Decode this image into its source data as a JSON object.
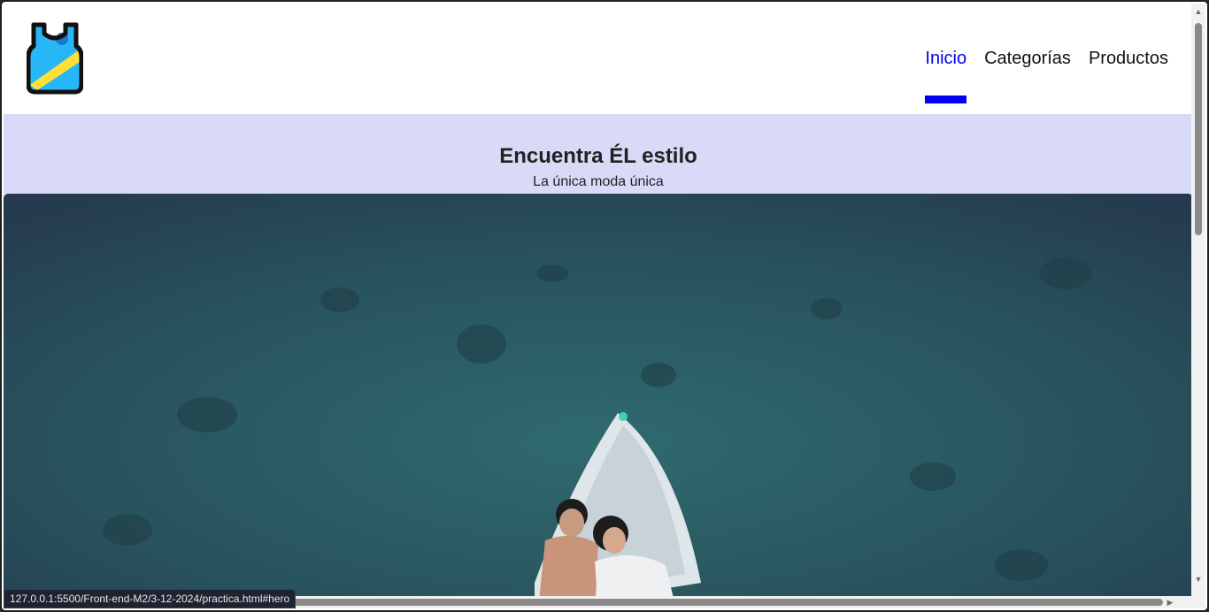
{
  "header": {
    "nav": [
      {
        "label": "Inicio",
        "active": true
      },
      {
        "label": "Categorías",
        "active": false
      },
      {
        "label": "Productos",
        "active": false
      }
    ]
  },
  "hero": {
    "title": "Encuentra ÉL estilo",
    "subtitle": "La única moda única"
  },
  "statusbar": {
    "url": "127.0.0.1:5500/Front-end-M2/3-12-2024/practica.html#hero"
  },
  "colors": {
    "accent": "#0000ee",
    "hero_band": "#d8daf7",
    "logo_blue": "#29b6f6",
    "logo_yellow": "#ffe135"
  },
  "icons": {
    "logo": "tank-top-icon"
  }
}
